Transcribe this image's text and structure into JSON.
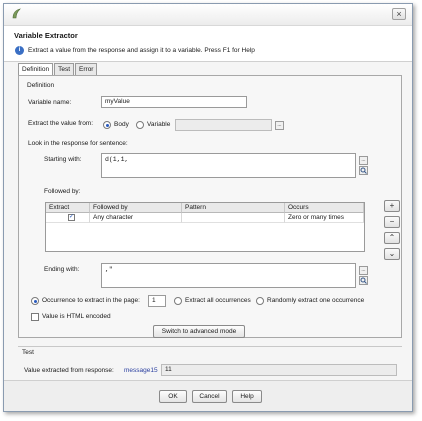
{
  "window": {
    "close_glyph": "×"
  },
  "header": {
    "title": "Variable Extractor",
    "description": "Extract a value from the response and assign it to a variable. Press F1 for Help",
    "info_glyph": "i"
  },
  "tabs": [
    {
      "label": "Definition",
      "active": true
    },
    {
      "label": "Test",
      "active": false
    },
    {
      "label": "Error",
      "active": false
    }
  ],
  "definition": {
    "section_label": "Definition",
    "variable_name_label": "Variable name:",
    "variable_name_value": "myValue",
    "extract_from_label": "Extract the value from:",
    "body_label": "Body",
    "variable_label": "Variable",
    "body_checked": true,
    "variable_field_value": "",
    "browse_glyph": "...",
    "look_in_label": "Look in the response for sentence:",
    "starting_with_label": "Starting with:",
    "starting_with_value": "d(1,1,",
    "followed_by_label": "Followed by:",
    "table": {
      "headers": [
        "Extract",
        "Followed by",
        "Pattern",
        "Occurs"
      ],
      "rows": [
        {
          "extract": true,
          "followed_by": "Any character",
          "pattern": "",
          "occurs": "Zero or many times"
        }
      ]
    },
    "side_buttons": [
      "+",
      "−",
      "⌃",
      "⌄"
    ],
    "ending_with_label": "Ending with:",
    "ending_with_value": ",\"",
    "occurrence_label": "Occurrence to extract in the page:",
    "occurrence_value": "1",
    "extract_all_label": "Extract all occurrences",
    "random_label": "Randomly extract one occurrence",
    "html_encoded_label": "Value is HTML encoded",
    "advanced_button": "Switch to advanced mode"
  },
  "test": {
    "section_label": "Test",
    "extracted_label": "Value extracted from response:",
    "message_link": "message15",
    "value": "11"
  },
  "footer": {
    "ok": "OK",
    "cancel": "Cancel",
    "help": "Help"
  },
  "colors": {
    "accent": "#2a5bbf",
    "link": "#2a3fa0",
    "info": "#3a6fc4"
  }
}
